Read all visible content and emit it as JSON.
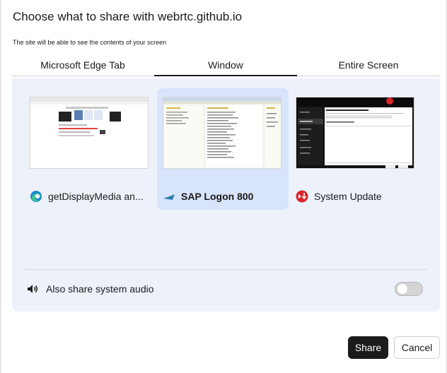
{
  "dialog": {
    "title": "Choose what to share with webrtc.github.io",
    "subtitle": "The site will be able to see the contents of your screen"
  },
  "tabs": [
    {
      "label": "Microsoft Edge Tab",
      "active": false
    },
    {
      "label": "Window",
      "active": true
    },
    {
      "label": "Entire Screen",
      "active": false
    }
  ],
  "sources": [
    {
      "label": "getDisplayMedia an...",
      "icon": "edge-icon",
      "selected": false
    },
    {
      "label": "SAP Logon 800",
      "icon": "sap-logon-icon",
      "selected": true
    },
    {
      "label": "System Update",
      "icon": "system-update-icon",
      "selected": false
    }
  ],
  "audio": {
    "label": "Also share system audio",
    "enabled": false
  },
  "buttons": {
    "share": "Share",
    "cancel": "Cancel"
  },
  "colors": {
    "panel_bg": "#edf1f9",
    "selected_bg": "#d7e4fb",
    "primary_button": "#1b1b1b"
  }
}
